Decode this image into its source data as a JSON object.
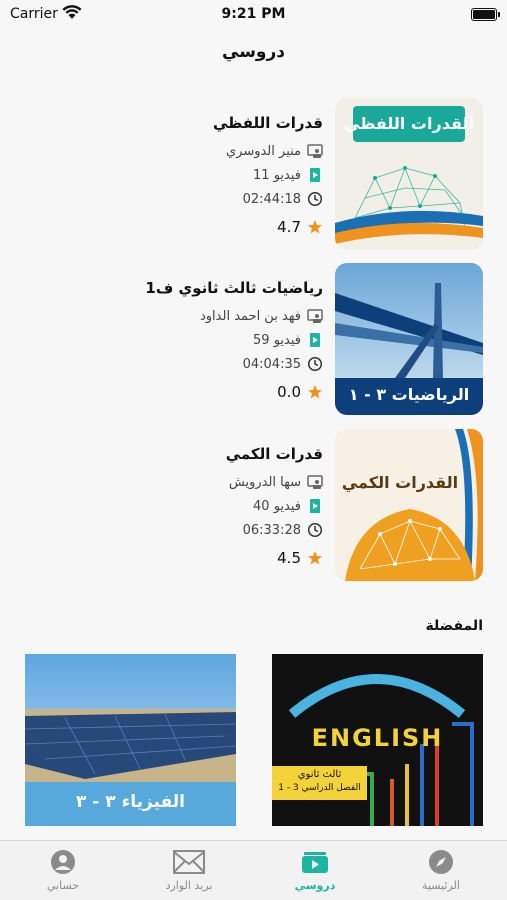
{
  "status_bar": {
    "carrier": "Carrier",
    "time": "9:21 PM"
  },
  "nav": {
    "title": "دروسي"
  },
  "courses": [
    {
      "title": "قدرات اللفظي",
      "teacher": "منير الدوسري",
      "videos": "11 فيديو",
      "duration": "02:44:18",
      "rating": "4.7",
      "thumb_text": "القدرات اللفظي"
    },
    {
      "title": "رياضيات ثالث ثانوي ف1",
      "teacher": "فهد بن احمد الداود",
      "videos": "59 فيديو",
      "duration": "04:04:35",
      "rating": "0.0",
      "thumb_text": "الرياضيات ٣ - ١"
    },
    {
      "title": "قدرات الكمي",
      "teacher": "سها الدرويش",
      "videos": "40 فيديو",
      "duration": "06:33:28",
      "rating": "4.5",
      "thumb_text": "القدرات الكمي"
    }
  ],
  "favorites": {
    "heading": "المفضلة",
    "items": [
      {
        "thumb_text": "ENGLISH",
        "sub1": "ثالث ثانوي",
        "sub2": "الفصل الدراسي 3 - 1"
      },
      {
        "thumb_text": "الفيزياء ٣ - ٣"
      }
    ]
  },
  "tabs": [
    {
      "label": "حسابي",
      "icon": "person-icon"
    },
    {
      "label": "بريد الوارد",
      "icon": "mail-icon"
    },
    {
      "label": "دروسي",
      "icon": "lessons-icon",
      "active": true
    },
    {
      "label": "الرئيسية",
      "icon": "compass-icon"
    }
  ],
  "colors": {
    "accent": "#1eb4a2",
    "star": "#f0921e",
    "dark_blue": "#0d3f7a"
  }
}
